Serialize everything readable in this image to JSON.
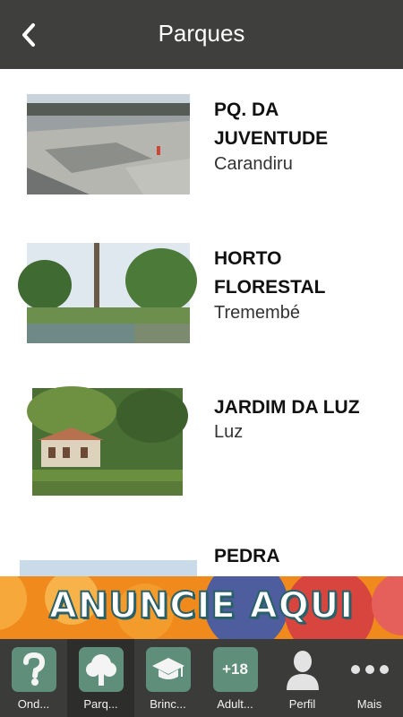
{
  "header": {
    "title": "Parques"
  },
  "parks": [
    {
      "name": "PQ. DA JUVENTUDE",
      "location": "Carandiru"
    },
    {
      "name": "HORTO FLORESTAL",
      "location": "Tremembé"
    },
    {
      "name": "JARDIM DA LUZ",
      "location": "Luz"
    },
    {
      "name": "PEDRA",
      "location": ""
    }
  ],
  "banner": {
    "text": "ANUNCIE AQUI",
    "colors": {
      "orange": "#f08a1c",
      "blue": "#4d5d9e",
      "red": "#d8443e"
    }
  },
  "tabs": [
    {
      "label": "Ond...",
      "icon": "question-icon"
    },
    {
      "label": "Parq...",
      "icon": "tree-icon"
    },
    {
      "label": "Brinc...",
      "icon": "graduation-cap-icon"
    },
    {
      "label": "Adult...",
      "icon": "plus-18-icon",
      "icon_text": "+18"
    },
    {
      "label": "Perfil",
      "icon": "person-icon"
    },
    {
      "label": "Mais",
      "icon": "more-dots-icon"
    }
  ],
  "active_tab": "Parq...",
  "accent_color": "#5f8f7a"
}
